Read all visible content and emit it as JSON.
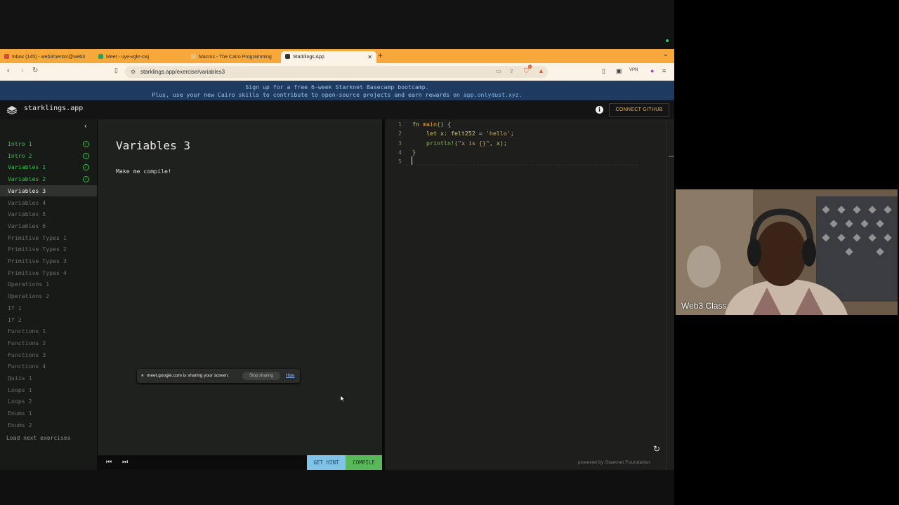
{
  "browser": {
    "tabs": [
      {
        "label": "Inbox (145) - web3mentor@web3",
        "favicon_color": "#d24a3a"
      },
      {
        "label": "Meet - uye-vgkr-cwj",
        "favicon_color": "#2e9e5a"
      },
      {
        "label": "Macros - The Cairo Programming",
        "favicon_color": "#e8c27a"
      },
      {
        "label": "Starklings App",
        "favicon_color": "#333333"
      }
    ],
    "url": "starklings.app/exercise/variables3",
    "vpn_label": "VPN",
    "notification_count": "1"
  },
  "banner": {
    "line1": "Sign up for a free 6-week Starknet Basecamp bootcamp.",
    "line2_prefix": "Plus, use your new Cairo skills to contribute to open-source projects and earn rewards on ",
    "line2_link": "app.onlydust.xyz",
    "line2_suffix": "."
  },
  "app": {
    "name": "starklings.app",
    "connect_github": "CONNECT GITHUB"
  },
  "sidebar": {
    "items": [
      {
        "label": "Intro 1",
        "state": "done"
      },
      {
        "label": "Intro 2",
        "state": "done"
      },
      {
        "label": "Variables 1",
        "state": "done"
      },
      {
        "label": "Variables 2",
        "state": "done"
      },
      {
        "label": "Variables 3",
        "state": "current"
      },
      {
        "label": "Variables 4",
        "state": "todo"
      },
      {
        "label": "Variables 5",
        "state": "todo"
      },
      {
        "label": "Variables 6",
        "state": "todo"
      },
      {
        "label": "Primitive Types 1",
        "state": "todo"
      },
      {
        "label": "Primitive Types 2",
        "state": "todo"
      },
      {
        "label": "Primitive Types 3",
        "state": "todo"
      },
      {
        "label": "Primitive Types 4",
        "state": "todo"
      },
      {
        "label": "Operations 1",
        "state": "todo"
      },
      {
        "label": "Operations 2",
        "state": "todo"
      },
      {
        "label": "If 1",
        "state": "todo"
      },
      {
        "label": "If 2",
        "state": "todo"
      },
      {
        "label": "Functions 1",
        "state": "todo"
      },
      {
        "label": "Functions 2",
        "state": "todo"
      },
      {
        "label": "Functions 3",
        "state": "todo"
      },
      {
        "label": "Functions 4",
        "state": "todo"
      },
      {
        "label": "Quizs 1",
        "state": "todo"
      },
      {
        "label": "Loops 1",
        "state": "todo"
      },
      {
        "label": "Loops 2",
        "state": "todo"
      },
      {
        "label": "Enums 1",
        "state": "todo"
      },
      {
        "label": "Enums 2",
        "state": "todo"
      }
    ],
    "load_next": "Load next exercises"
  },
  "exercise": {
    "title": "Variables 3",
    "description": "Make me compile!",
    "get_hint": "GET HINT",
    "compile": "COMPILE"
  },
  "share_toast": {
    "text": "meet.google.com is sharing your screen.",
    "stop": "Stop sharing",
    "hide": "Hide"
  },
  "editor": {
    "lines": [
      {
        "n": "1",
        "parts": [
          [
            "kw",
            "fn "
          ],
          [
            "fnname",
            "main"
          ],
          [
            "txt",
            "() {"
          ]
        ]
      },
      {
        "n": "2",
        "parts": [
          [
            "kw",
            "    let "
          ],
          [
            "txt",
            "x: felt252 = "
          ],
          [
            "str",
            "'hello'"
          ],
          [
            "txt",
            ";"
          ]
        ]
      },
      {
        "n": "3",
        "parts": [
          [
            "mac",
            "    println!"
          ],
          [
            "txt",
            "("
          ],
          [
            "str",
            "\"x is {}\""
          ],
          [
            "txt",
            ", x);"
          ]
        ]
      },
      {
        "n": "4",
        "parts": [
          [
            "kw",
            "}"
          ]
        ]
      },
      {
        "n": "5",
        "parts": []
      }
    ],
    "powered_by": "powered by Starknet Foundation"
  },
  "webcam": {
    "participant": "Web3 Class"
  }
}
